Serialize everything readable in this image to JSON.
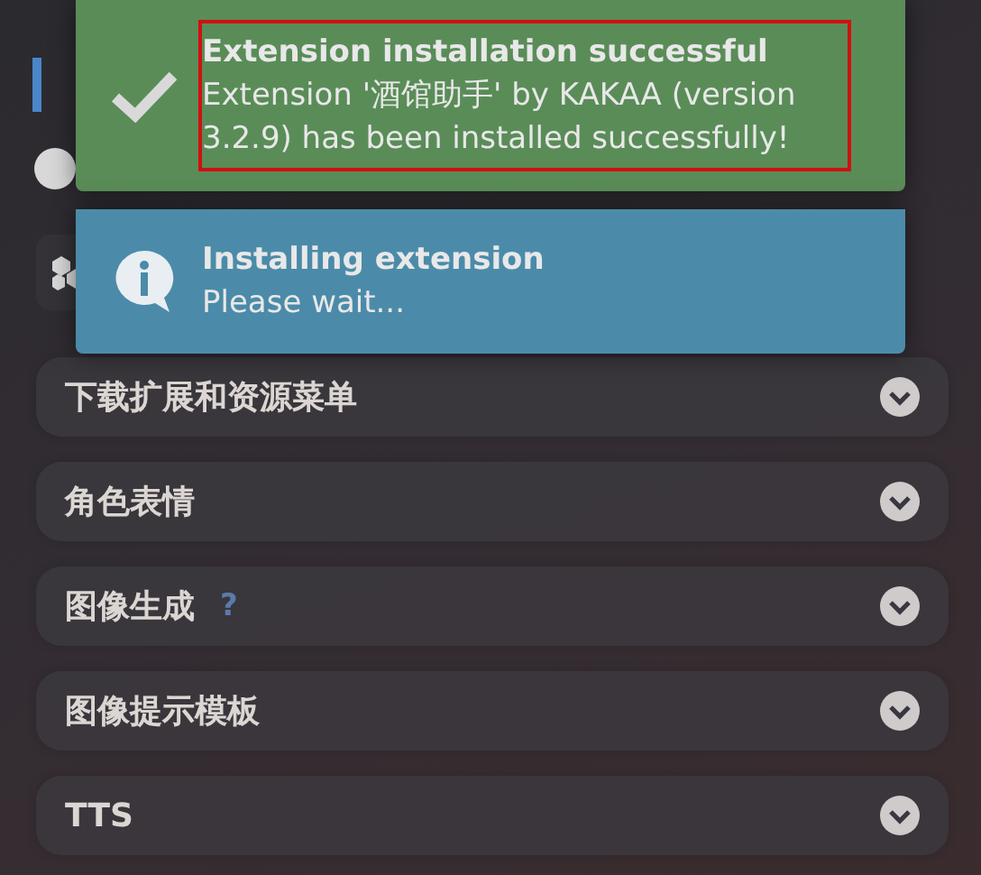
{
  "toasts": [
    {
      "kind": "success",
      "title": "Extension installation successful",
      "message": "Extension '酒馆助手' by KAKAA (version 3.2.9) has been installed successfully!",
      "highlighted": true
    },
    {
      "kind": "info",
      "title": "Installing extension",
      "message": "Please wait...",
      "highlighted": false
    }
  ],
  "drawers": [
    {
      "label": "下载扩展和资源菜单",
      "expanded": false
    },
    {
      "label": "角色表情",
      "expanded": false
    },
    {
      "label": "图像生成",
      "help": "?",
      "expanded": false
    },
    {
      "label": "图像提示模板",
      "expanded": false
    },
    {
      "label": "TTS",
      "expanded": false
    }
  ]
}
